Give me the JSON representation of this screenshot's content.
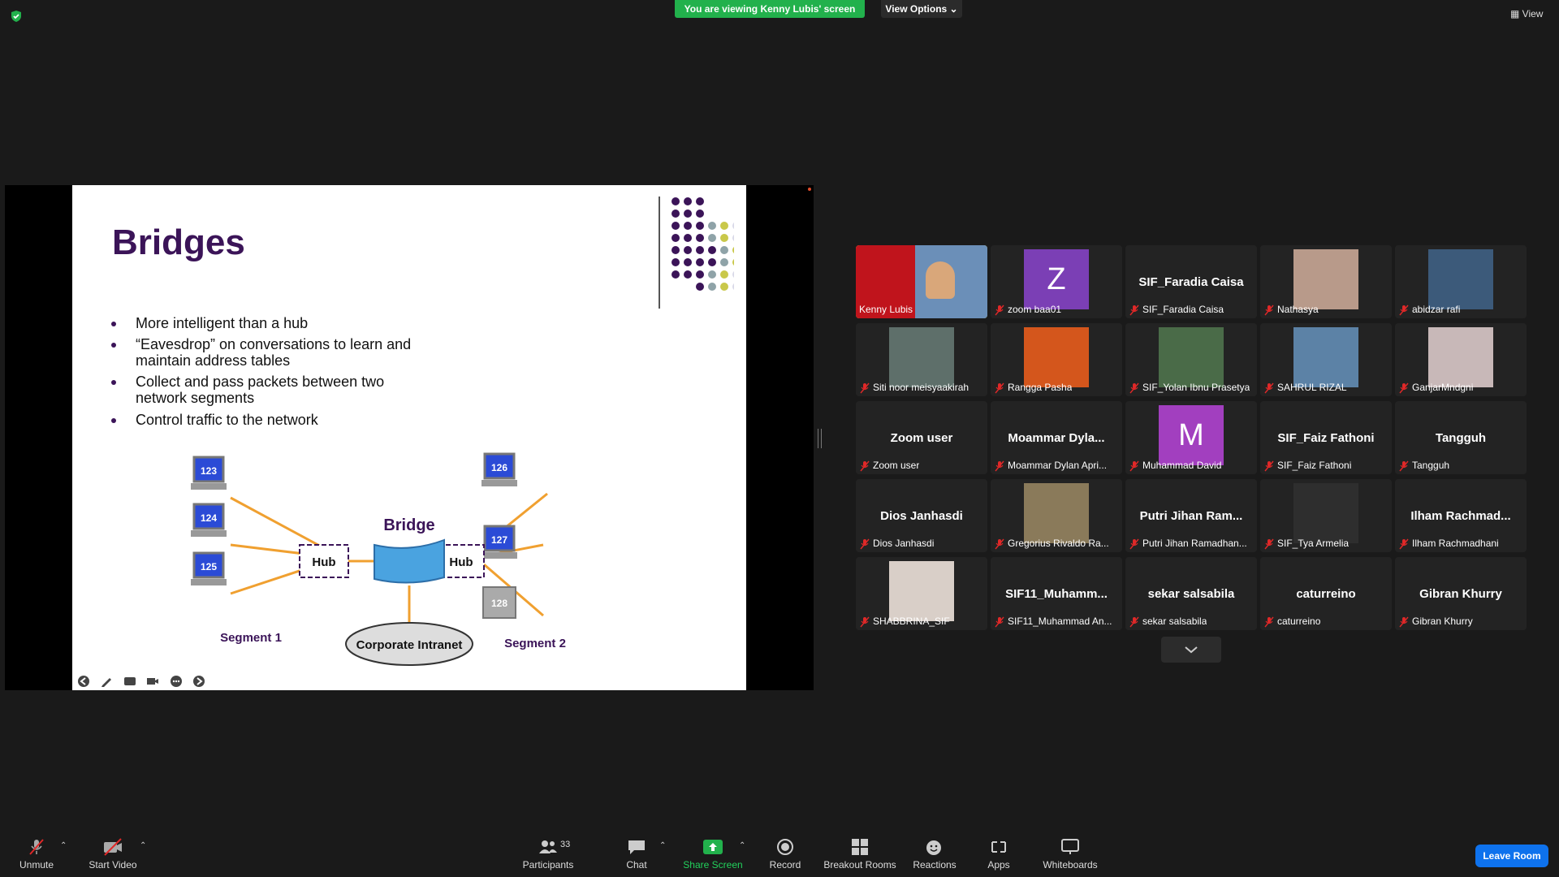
{
  "top": {
    "banner": "You are viewing Kenny Lubis' screen",
    "view_options": "View Options ⌄",
    "view_label": "View"
  },
  "slide": {
    "title": "Bridges",
    "bullets": [
      "More intelligent than a hub",
      "“Eavesdrop” on conversations to learn and maintain address tables",
      "Collect and pass packets between two network segments",
      "Control traffic to the network"
    ],
    "diagram": {
      "computers_left": [
        "123",
        "124",
        "125"
      ],
      "computers_right": [
        "126",
        "127",
        "128"
      ],
      "hub_label": "Hub",
      "bridge_label": "Bridge",
      "cloud_label": "Corporate Intranet",
      "segment1": "Segment 1",
      "segment2": "Segment 2"
    }
  },
  "participants": [
    {
      "name": "Kenny Lubis",
      "type": "video",
      "active": true
    },
    {
      "name": "zoom baa01",
      "type": "letter",
      "letter": "Z",
      "color": "#7b3fb5"
    },
    {
      "name": "SIF_Faradia Caisa",
      "display": "SIF_Faradia Caisa",
      "type": "name"
    },
    {
      "name": "Nathasya",
      "type": "photo",
      "color": "#b89a8a"
    },
    {
      "name": "abidzar rafi",
      "type": "photo",
      "color": "#3c5a7a"
    },
    {
      "name": "Siti noor meisyaakirah",
      "type": "photo",
      "color": "#5e6f6a"
    },
    {
      "name": "Rangga Pasha",
      "type": "photo",
      "color": "#d4561c"
    },
    {
      "name": "SIF_Yolan Ibnu Prasetya",
      "type": "photo",
      "color": "#4a6b48"
    },
    {
      "name": "SAHRUL RIZAL",
      "type": "photo",
      "color": "#5c82a6"
    },
    {
      "name": "GanjarMndgni",
      "type": "photo",
      "color": "#c8b8b8"
    },
    {
      "name": "Zoom user",
      "display": "Zoom user",
      "type": "name"
    },
    {
      "name": "Moammar Dylan Apri...",
      "display": "Moammar  Dyla...",
      "type": "name"
    },
    {
      "name": "Muhammad David",
      "type": "letter",
      "letter": "M",
      "color": "#a23fbf"
    },
    {
      "name": "SIF_Faiz Fathoni",
      "display": "SIF_Faiz Fathoni",
      "type": "name"
    },
    {
      "name": "Tangguh",
      "display": "Tangguh",
      "type": "name"
    },
    {
      "name": "Dios Janhasdi",
      "display": "Dios Janhasdi",
      "type": "name"
    },
    {
      "name": "Gregorius Rivaldo Ra...",
      "type": "photo",
      "color": "#8a7a5a"
    },
    {
      "name": "Putri Jihan Ramadhan...",
      "display": "Putri Jihan  Ram...",
      "type": "name"
    },
    {
      "name": "SIF_Tya Armelia",
      "type": "photo",
      "color": "#2e2e2e"
    },
    {
      "name": "Ilham Rachmadhani",
      "display": "Ilham  Rachmad...",
      "type": "name"
    },
    {
      "name": "SHABBRINA_SIF",
      "type": "photo",
      "color": "#d9cfc8"
    },
    {
      "name": "SIF11_Muhammad An...",
      "display": "SIF11_Muhamm...",
      "type": "name"
    },
    {
      "name": "sekar salsabila",
      "display": "sekar salsabila",
      "type": "name"
    },
    {
      "name": "caturreino",
      "display": "caturreino",
      "type": "name"
    },
    {
      "name": "Gibran Khurry",
      "display": "Gibran Khurry",
      "type": "name"
    }
  ],
  "toolbar": {
    "unmute": "Unmute",
    "start_video": "Start Video",
    "participants": "Participants",
    "participants_count": "33",
    "chat": "Chat",
    "share_screen": "Share Screen",
    "record": "Record",
    "breakout_rooms": "Breakout Rooms",
    "reactions": "Reactions",
    "apps": "Apps",
    "whiteboards": "Whiteboards",
    "leave": "Leave Room"
  },
  "colors": {
    "share_green": "#22b14c",
    "active_speaker": "#f4e04d",
    "leave_blue": "#0e72ed",
    "slide_title": "#3b1458",
    "diagram_line": "#f0a030",
    "monitor_blue": "#2b4bd6"
  }
}
